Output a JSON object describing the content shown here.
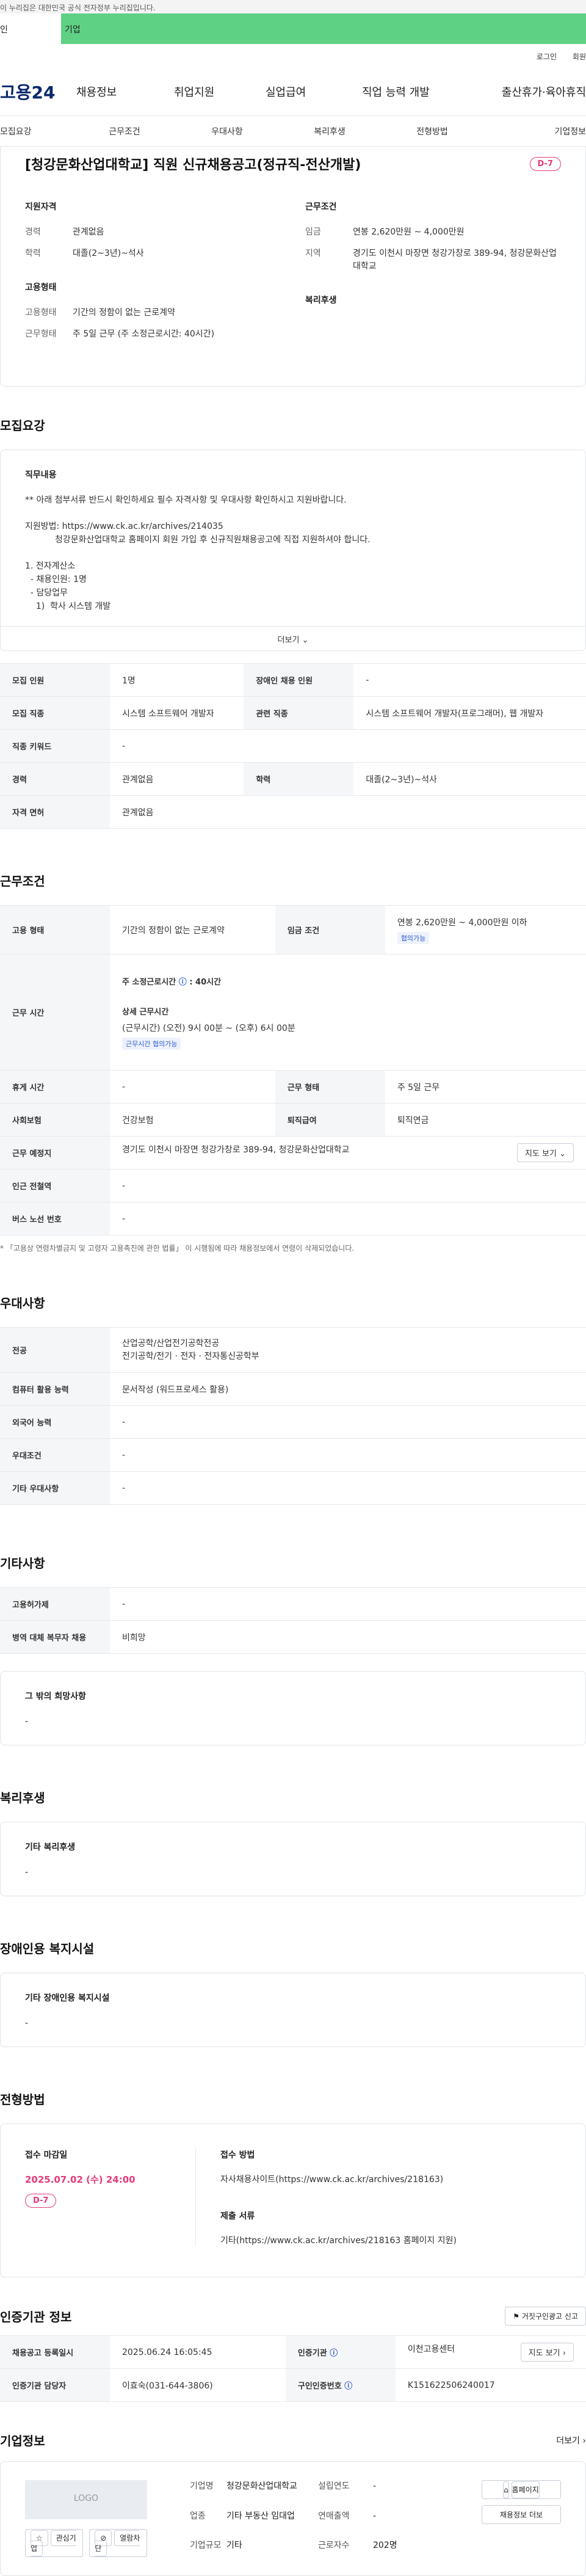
{
  "gov_banner": "이 누리집은 대한민국 공식 전자정부 누리집입니다.",
  "tabs": {
    "person": "인",
    "corp": "기업"
  },
  "util": {
    "login": "로그인",
    "join": "회원"
  },
  "gnb": {
    "logo": "고용24",
    "menus": [
      "채용정보",
      "취업지원",
      "실업급여",
      "직업 능력 개발",
      "출산휴가·육아휴직"
    ]
  },
  "subnav": [
    "모집요강",
    "근무조건",
    "우대사항",
    "복리후생",
    "전형방법",
    "기업정보"
  ],
  "job": {
    "title": "[청강문화산업대학교] 직원 신규채용공고(정규직-전산개발)",
    "dday": "D-7",
    "qual_title": "지원자격",
    "qual": [
      {
        "k": "경력",
        "v": "관계없음"
      },
      {
        "k": "학력",
        "v": "대졸(2~3년)~석사"
      }
    ],
    "cond_title": "근무조건",
    "cond": [
      {
        "k": "임금",
        "v": "연봉 2,620만원 ~ 4,000만원"
      },
      {
        "k": "지역",
        "v": "경기도 이천시 마장면 청강가창로 389-94, 청강문화산업대학교"
      }
    ],
    "emp_title": "고용형태",
    "emp": [
      {
        "k": "고용형태",
        "v": "기간의 정함이 없는 근로계약"
      },
      {
        "k": "근무형태",
        "v": "주 5일 근무 (주 소정근로시간: 40시간)"
      }
    ],
    "welfare_title": "복리후생"
  },
  "recruit": {
    "title": "모집요강",
    "desc_title": "직무내용",
    "desc_text": "** 아래 첨부서류 반드시 확인하세요 필수 자격사항 및 우대사항 확인하시고 지원바랍니다.\n\n지원방법: https://www.ck.ac.kr/archives/214035\n           청강문화산업대학교 홈페이지 회원 가입 후 신규직원채용공고에 직접 지원하셔야 합니다.\n\n1. 전자계산소\n  - 채용인원: 1명\n  - 담당업무\n    1)  학사 시스템 개발",
    "more": "더보기",
    "rows": [
      [
        {
          "k": "모집 인원",
          "v": "1명"
        },
        {
          "k": "장애인 채용 인원",
          "v": "-"
        }
      ],
      [
        {
          "k": "모집 직종",
          "v": "시스템 소프트웨어 개발자"
        },
        {
          "k": "관련 직종",
          "v": "시스템 소프트웨어 개발자(프로그래머), 웹 개발자"
        }
      ],
      [
        {
          "k": "직종 키워드",
          "v": "-"
        }
      ],
      [
        {
          "k": "경력",
          "v": "관계없음"
        },
        {
          "k": "학력",
          "v": "대졸(2~3년)~석사"
        }
      ],
      [
        {
          "k": "자격 면허",
          "v": "관계없음"
        }
      ]
    ]
  },
  "work": {
    "title": "근무조건",
    "emp_k": "고용 형태",
    "emp_v": "기간의 정함이 없는 근로계약",
    "wage_k": "임금 조건",
    "wage_v": "연봉 2,620만원 ~ 4,000만원 이하",
    "wage_badge": "협의가능",
    "hours_k": "근무 시간",
    "hours_total_label": "주 소정근로시간",
    "hours_total": ": 40시간",
    "hours_detail_label": "상세 근무시간",
    "hours_detail": "(근무시간) (오전) 9시 00분 ~ (오후) 6시 00분",
    "hours_badge": "근무시간 협의가능",
    "rest_k": "휴게 시간",
    "rest_v": "-",
    "type_k": "근무 형태",
    "type_v": "주 5일 근무",
    "ins_k": "사회보험",
    "ins_v": "건강보험",
    "ret_k": "퇴직급여",
    "ret_v": "퇴직연금",
    "place_k": "근무 예정지",
    "place_v": "경기도 이천시 마장면 청강가창로 389-94, 청강문화산업대학교",
    "map_btn": "지도 보기",
    "station_k": "인근 전철역",
    "station_v": "-",
    "bus_k": "버스 노선 번호",
    "bus_v": "-",
    "note": "* 「고용상 연령차별금지 및 고령자 고용촉진에 관한 법률」 이 시행됨에 따라 채용정보에서 연령이 삭제되었습니다."
  },
  "pref": {
    "title": "우대사항",
    "rows": [
      {
        "k": "전공",
        "v": "산업공학/산업전기공학전공\n전기공학/전기 · 전자 · 전자통신공학부"
      },
      {
        "k": "컴퓨터 활용 능력",
        "v": "문서작성 (워드프로세스 활용)"
      },
      {
        "k": "외국어 능력",
        "v": "-"
      },
      {
        "k": "우대조건",
        "v": "-"
      },
      {
        "k": "기타 우대사항",
        "v": "-"
      }
    ]
  },
  "etc": {
    "title": "기타사항",
    "rows": [
      {
        "k": "고용허가제",
        "v": "-"
      },
      {
        "k": "병역 대체 복무자 채용",
        "v": "비희망"
      }
    ],
    "hope_title": "그 밖의 희망사항",
    "hope_v": "-"
  },
  "welfare": {
    "title": "복리후생",
    "box_title": "기타 복리후생",
    "box_v": "-"
  },
  "disability": {
    "title": "장애인용 복지시설",
    "box_title": "기타 장애인용 복지시설",
    "box_v": "-"
  },
  "process": {
    "title": "전형방법",
    "deadline_title": "접수 마감일",
    "deadline": "2025.07.02 (수) 24:00",
    "dday": "D-7",
    "method_title": "접수 방법",
    "method": "자사채용사이트(https://www.ck.ac.kr/archives/218163)",
    "docs_title": "제출 서류",
    "docs": "기타(https://www.ck.ac.kr/archives/218163 홈페이지 지원)"
  },
  "cert": {
    "title": "인증기관 정보",
    "report_btn": "거짓구인광고 신고",
    "reg_k": "채용공고 등록일시",
    "reg_v": "2025.06.24 16:05:45",
    "org_k": "인증기관",
    "org_v": "이천고용센터",
    "org_map": "지도 보기",
    "mgr_k": "인증기관 담당자",
    "mgr_v": "이효숙(031-644-3806)",
    "num_k": "구인인증번호",
    "num_v": "K151622506240017"
  },
  "company": {
    "title": "기업정보",
    "more": "더보기",
    "logo": "LOGO",
    "fav": "관심기업",
    "block": "열람차단",
    "name_k": "기업명",
    "name_v": "청강문화산업대학교",
    "found_k": "설립연도",
    "found_v": "-",
    "ind_k": "업종",
    "ind_v": "기타 부동산 임대업",
    "sales_k": "연매출액",
    "sales_v": "-",
    "emp_k": "근로자수",
    "emp_v": "202명",
    "size_k": "기업규모",
    "size_v": "기타",
    "home_btn": "홈페이지",
    "jobs_btn": "채용정보 더보"
  }
}
